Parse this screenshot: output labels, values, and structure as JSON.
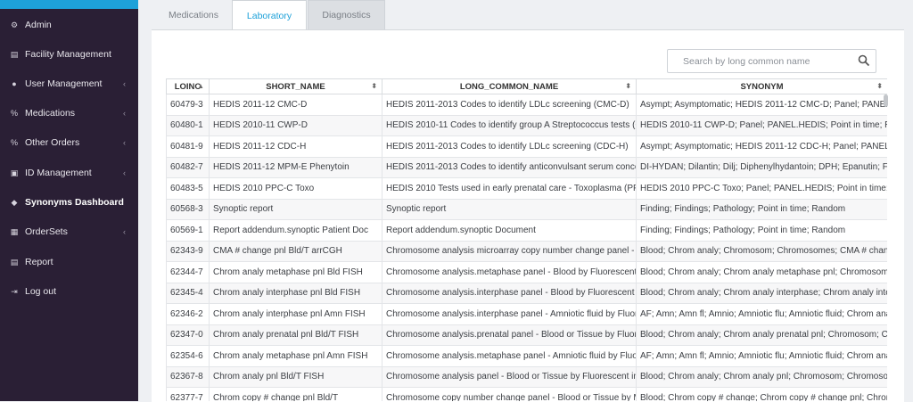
{
  "sidebar": {
    "items": [
      {
        "label": "Admin",
        "icon": "gear-icon",
        "glyph": "⚙",
        "chevron": false
      },
      {
        "label": "Facility Management",
        "icon": "building-icon",
        "glyph": "▤",
        "chevron": false
      },
      {
        "label": "User Management",
        "icon": "user-icon",
        "glyph": "●",
        "chevron": true
      },
      {
        "label": "Medications",
        "icon": "pill-icon",
        "glyph": "%",
        "chevron": true
      },
      {
        "label": "Other Orders",
        "icon": "orders-icon",
        "glyph": "%",
        "chevron": true
      },
      {
        "label": "ID Management",
        "icon": "id-card-icon",
        "glyph": "▣",
        "chevron": true
      },
      {
        "label": "Synonyms Dashboard",
        "icon": "tags-icon",
        "glyph": "◆",
        "chevron": false
      },
      {
        "label": "OrderSets",
        "icon": "grid-icon",
        "glyph": "▦",
        "chevron": true
      },
      {
        "label": "Report",
        "icon": "report-icon",
        "glyph": "▤",
        "chevron": false
      },
      {
        "label": "Log out",
        "icon": "logout-icon",
        "glyph": "⇥",
        "chevron": false
      }
    ]
  },
  "tabs": {
    "medications": "Medications",
    "laboratory": "Laboratory",
    "diagnostics": "Diagnostics"
  },
  "search": {
    "placeholder": "Search by long common name"
  },
  "table": {
    "headers": [
      "LOINC",
      "SHORT_NAME",
      "LONG_COMMON_NAME",
      "SYNONYM"
    ],
    "rows": [
      [
        "60479-3",
        "HEDIS 2011-12 CMC-D",
        "HEDIS 2011-2013 Codes to identify LDLc screening (CMC-D)",
        "Asympt; Asymptomatic; HEDIS 2011-12 CMC-D; Panel; PANEL.HEDIS"
      ],
      [
        "60480-1",
        "HEDIS 2010-11 CWP-D",
        "HEDIS 2010-11 Codes to identify group A Streptococcus tests (CWP-D)",
        "HEDIS 2010-11 CWP-D; Panel; PANEL.HEDIS; Point in time; Random"
      ],
      [
        "60481-9",
        "HEDIS 2011-12 CDC-H",
        "HEDIS 2011-2013 Codes to identify LDLc screening (CDC-H)",
        "Asympt; Asymptomatic; HEDIS 2011-12 CDC-H; Panel; PANEL.HEDIS"
      ],
      [
        "60482-7",
        "HEDIS 2011-12 MPM-E Phenytoin",
        "HEDIS 2011-2013 Codes to identify anticonvulsant serum concentration",
        "DI-HYDAN; Dilantin; Dilj; Diphenylhydantoin; DPH; Epanutin; Fenitoin"
      ],
      [
        "60483-5",
        "HEDIS 2010 PPC-C Toxo",
        "HEDIS 2010 Tests used in early prenatal care - Toxoplasma (PPC-C)",
        "HEDIS 2010 PPC-C Toxo; Panel; PANEL.HEDIS; Point in time; Random"
      ],
      [
        "60568-3",
        "Synoptic report",
        "Synoptic report",
        "Finding; Findings; Pathology; Point in time; Random"
      ],
      [
        "60569-1",
        "Report addendum.synoptic Patient Doc",
        "Report addendum.synoptic Document",
        "Finding; Findings; Pathology; Point in time; Random"
      ],
      [
        "62343-9",
        "CMA # change pnl Bld/T arrCGH",
        "Chromosome analysis microarray copy number change panel - Blood",
        "Blood; Chrom analy; Chromosom; Chromosomes; CMA # change"
      ],
      [
        "62344-7",
        "Chrom analy metaphase pnl Bld FISH",
        "Chromosome analysis.metaphase panel - Blood by Fluorescent in situ",
        "Blood; Chrom analy; Chrom analy metaphase pnl; Chromosom"
      ],
      [
        "62345-4",
        "Chrom analy interphase pnl Bld FISH",
        "Chromosome analysis.interphase panel - Blood by Fluorescent in situ",
        "Blood; Chrom analy; Chrom analy interphase; Chrom analy interphase"
      ],
      [
        "62346-2",
        "Chrom analy interphase pnl Amn FISH",
        "Chromosome analysis.interphase panel - Amniotic fluid by Fluorescent",
        "AF; Amn; Amn fl; Amnio; Amniotic flu; Amniotic fluid; Chrom analy"
      ],
      [
        "62347-0",
        "Chrom analy prenatal pnl Bld/T FISH",
        "Chromosome analysis.prenatal panel - Blood or Tissue by Fluorescent",
        "Blood; Chrom analy; Chrom analy prenatal pnl; Chromosom; Chrom"
      ],
      [
        "62354-6",
        "Chrom analy metaphase pnl Amn FISH",
        "Chromosome analysis.metaphase panel - Amniotic fluid by Fluorescent",
        "AF; Amn; Amn fl; Amnio; Amniotic flu; Amniotic fluid; Chrom analy"
      ],
      [
        "62367-8",
        "Chrom analy pnl Bld/T FISH",
        "Chromosome analysis panel - Blood or Tissue by Fluorescent in situ",
        "Blood; Chrom analy; Chrom analy pnl; Chromosom; Chromosomes"
      ],
      [
        "62377-7",
        "Chrom copy # change pnl Bld/T",
        "Chromosome copy number change panel - Blood or Tissue by Molecular",
        "Blood; Chrom copy # change; Chrom copy # change pnl; Chrom"
      ]
    ]
  }
}
